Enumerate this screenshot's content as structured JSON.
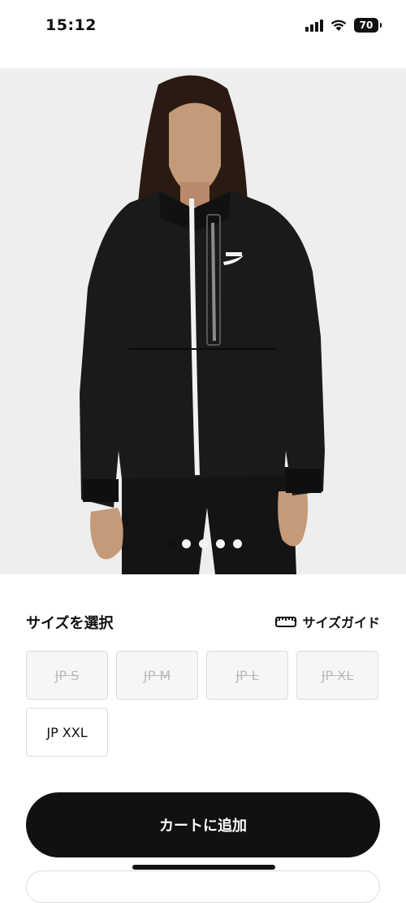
{
  "status_bar": {
    "time": "15:12",
    "battery": "70",
    "signal_icon": "cellular-signal-icon",
    "wifi_icon": "wifi-icon"
  },
  "product_image": {
    "carousel": {
      "total": 5,
      "active_index": 0
    }
  },
  "size_selector": {
    "title": "サイズを選択",
    "guide_label": "サイズガイド",
    "guide_icon": "ruler-icon",
    "sizes": [
      {
        "label": "JP S",
        "available": false
      },
      {
        "label": "JP M",
        "available": false
      },
      {
        "label": "JP L",
        "available": false
      },
      {
        "label": "JP XL",
        "available": false
      },
      {
        "label": "JP XXL",
        "available": true
      }
    ]
  },
  "actions": {
    "add_to_cart": "カートに追加"
  },
  "colors": {
    "primary": "#111111",
    "background": "#ffffff",
    "image_background": "#eeeeee",
    "disabled_bg": "#f6f6f6",
    "disabled_text": "#b9b9b9",
    "border": "#dcdcdc"
  }
}
